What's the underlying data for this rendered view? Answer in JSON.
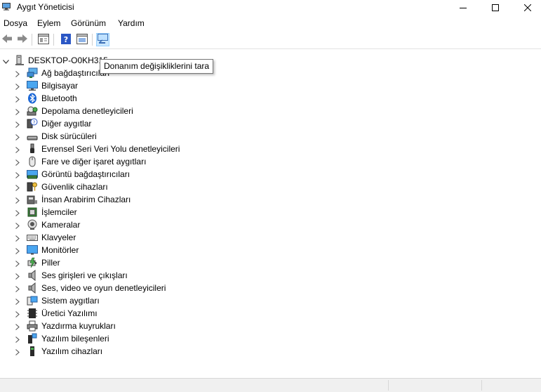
{
  "window": {
    "title": "Aygıt Yöneticisi"
  },
  "menu": [
    "Dosya",
    "Eylem",
    "Görünüm",
    "Yardım"
  ],
  "toolbar": {
    "buttons": [
      "back-icon",
      "forward-icon",
      "properties-icon",
      "help-icon",
      "view-icon",
      "scan-hardware-icon"
    ],
    "tooltip": "Donanım değişikliklerini tara"
  },
  "tree": {
    "root": "DESKTOP-O0KH315",
    "nodes": [
      {
        "label": "Ağ bağdaştırıcıları",
        "icon": "network-adapter-icon"
      },
      {
        "label": "Bilgisayar",
        "icon": "computer-icon"
      },
      {
        "label": "Bluetooth",
        "icon": "bluetooth-icon"
      },
      {
        "label": "Depolama denetleyicileri",
        "icon": "storage-controller-icon"
      },
      {
        "label": "Diğer aygıtlar",
        "icon": "other-devices-icon"
      },
      {
        "label": "Disk sürücüleri",
        "icon": "disk-drive-icon"
      },
      {
        "label": "Evrensel Seri Veri Yolu denetleyicileri",
        "icon": "usb-icon"
      },
      {
        "label": "Fare ve diğer işaret aygıtları",
        "icon": "mouse-icon"
      },
      {
        "label": "Görüntü bağdaştırıcıları",
        "icon": "display-adapter-icon"
      },
      {
        "label": "Güvenlik cihazları",
        "icon": "security-device-icon"
      },
      {
        "label": "İnsan Arabirim Cihazları",
        "icon": "hid-icon"
      },
      {
        "label": "İşlemciler",
        "icon": "processor-icon"
      },
      {
        "label": "Kameralar",
        "icon": "camera-icon"
      },
      {
        "label": "Klavyeler",
        "icon": "keyboard-icon"
      },
      {
        "label": "Monitörler",
        "icon": "monitor-icon"
      },
      {
        "label": "Piller",
        "icon": "battery-icon"
      },
      {
        "label": "Ses girişleri ve çıkışları",
        "icon": "audio-io-icon"
      },
      {
        "label": "Ses, video ve oyun denetleyicileri",
        "icon": "sound-video-icon"
      },
      {
        "label": "Sistem aygıtları",
        "icon": "system-devices-icon"
      },
      {
        "label": "Üretici Yazılımı",
        "icon": "firmware-icon"
      },
      {
        "label": "Yazdırma kuyrukları",
        "icon": "print-queue-icon"
      },
      {
        "label": "Yazılım bileşenleri",
        "icon": "software-component-icon"
      },
      {
        "label": "Yazılım cihazları",
        "icon": "software-device-icon"
      }
    ]
  }
}
